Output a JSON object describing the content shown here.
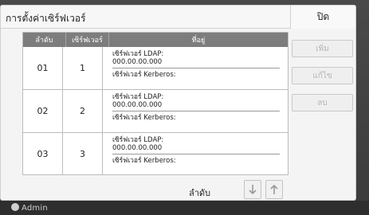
{
  "dialog": {
    "title": "การตั้งค่าเซิร์ฟเวอร์",
    "close_label": "ปิด"
  },
  "table": {
    "headers": {
      "order": "ลำดับ",
      "server": "เซิร์ฟเวอร์",
      "address": "ที่อยู่"
    },
    "rows": [
      {
        "order": "01",
        "server": "1",
        "ldap_label": "เซิร์ฟเวอร์ LDAP:",
        "ldap_value": "000.00.00.000",
        "kerberos_label": "เซิร์ฟเวอร์ Kerberos:"
      },
      {
        "order": "02",
        "server": "2",
        "ldap_label": "เซิร์ฟเวอร์ LDAP:",
        "ldap_value": "000.00.00.000",
        "kerberos_label": "เซิร์ฟเวอร์ Kerberos:"
      },
      {
        "order": "03",
        "server": "3",
        "ldap_label": "เซิร์ฟเวอร์ LDAP:",
        "ldap_value": "000.00.00.000",
        "kerberos_label": "เซิร์ฟเวอร์ Kerberos:"
      }
    ]
  },
  "actions": {
    "add": "เพิ่ม",
    "edit": "แก้ไข",
    "delete": "ลบ"
  },
  "sort": {
    "label": "ลำดับ"
  },
  "background": {
    "user": "Admin"
  },
  "icons": {
    "down": "arrow-down-icon",
    "up": "arrow-up-icon",
    "user": "user-icon"
  },
  "colors": {
    "header_bg": "#7d7d7d",
    "disabled_text": "#b5b5b5"
  }
}
